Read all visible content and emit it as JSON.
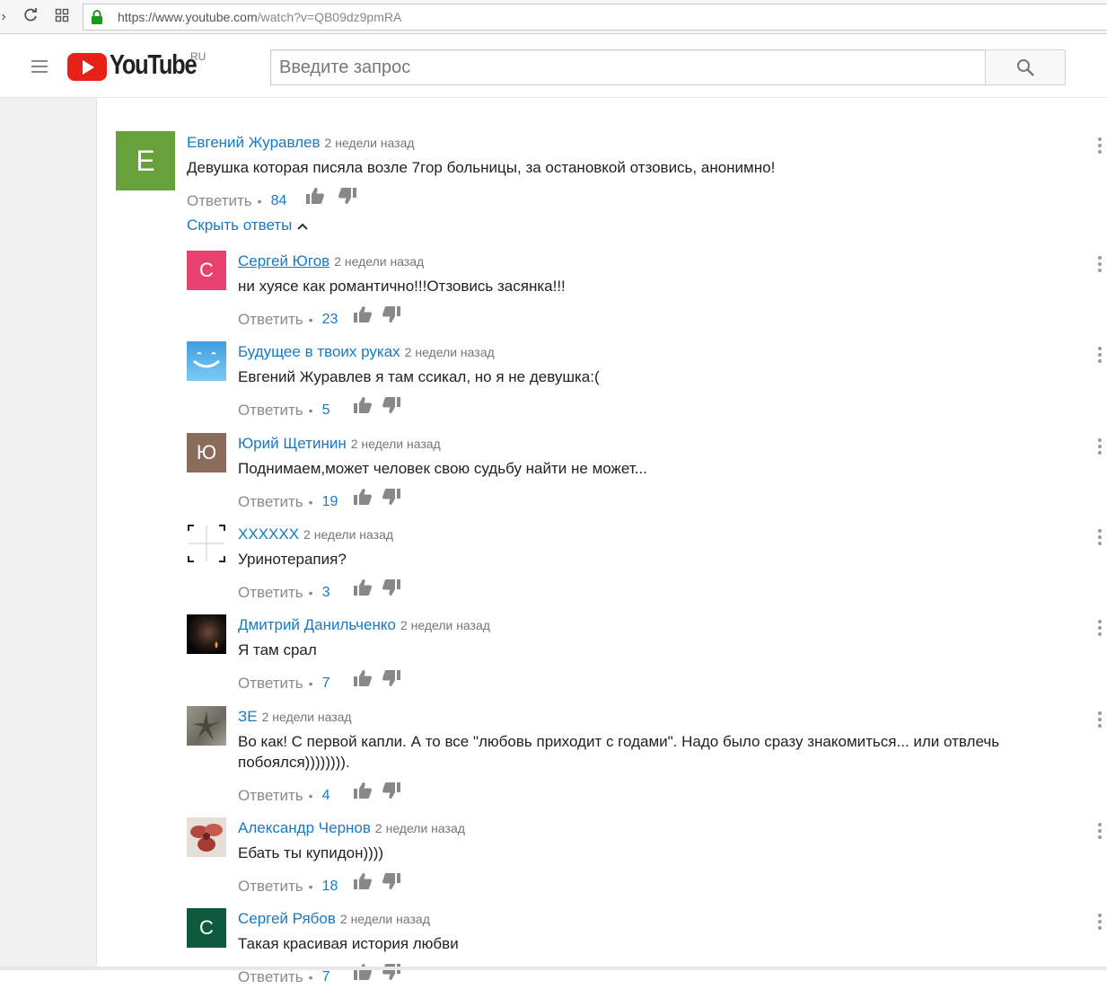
{
  "browser": {
    "url_host": "https://www.youtube.com",
    "url_path": "/watch?v=QB09dz9pmRA"
  },
  "header": {
    "logo_text": "YouTube",
    "logo_region": "RU",
    "search_placeholder": "Введите запрос"
  },
  "thread": {
    "top": {
      "author": "Евгений Журавлев",
      "avatar_letter": "Е",
      "avatar_color": "#67a13c",
      "time": "2 недели назад",
      "text": "Девушка которая писяла возле 7гор больницы, за остановкой отзовись, анонимно!",
      "reply_label": "Ответить",
      "likes": "84"
    },
    "toggle_label": "Скрыть ответы",
    "replies": [
      {
        "author": "Сергей Югов",
        "time": "2 недели назад",
        "text": "ни хуясе как романтично!!!Отзовись засянка!!!",
        "reply_label": "Ответить",
        "likes": "23",
        "avatar_letter": "С",
        "avatar_color": "#e8416f"
      },
      {
        "author": "Будущее в твоих руках",
        "time": "2 недели назад",
        "text": "Евгений Журавлев я там ссикал, но я не девушка:(",
        "reply_label": "Ответить",
        "likes": "5",
        "avatar_letter": "",
        "avatar_color": "#4aa9e6"
      },
      {
        "author": "Юрий Щетинин",
        "time": "2 недели назад",
        "text": "Поднимаем,может человек свою судьбу найти не может...",
        "reply_label": "Ответить",
        "likes": "19",
        "avatar_letter": "Ю",
        "avatar_color": "#8b6b5c"
      },
      {
        "author": "XXXXXX",
        "time": "2 недели назад",
        "text": "Уринотерапия?",
        "reply_label": "Ответить",
        "likes": "3",
        "avatar_letter": "",
        "avatar_color": "#ffffff"
      },
      {
        "author": "Дмитрий Данильченко",
        "time": "2 недели назад",
        "text": "Я там срал",
        "reply_label": "Ответить",
        "likes": "7",
        "avatar_letter": "",
        "avatar_color": "#1a1a1a"
      },
      {
        "author": "ЗЕ",
        "time": "2 недели назад",
        "text": "Во как! С первой капли.  А то все \"любовь приходит с годами\". Надо было сразу знакомиться... или отвлечь побоялся)))))))).",
        "reply_label": "Ответить",
        "likes": "4",
        "avatar_letter": "",
        "avatar_color": "#8a8a7a"
      },
      {
        "author": "Александр Чернов",
        "time": "2 недели назад",
        "text": "Ебать ты купидон))))",
        "reply_label": "Ответить",
        "likes": "18",
        "avatar_letter": "",
        "avatar_color": "#d9d2cc"
      },
      {
        "author": "Сергей Рябов",
        "time": "2 недели назад",
        "text": "Такая красивая история любви",
        "reply_label": "Ответить",
        "likes": "7",
        "avatar_letter": "С",
        "avatar_color": "#0f5a3e"
      }
    ]
  }
}
